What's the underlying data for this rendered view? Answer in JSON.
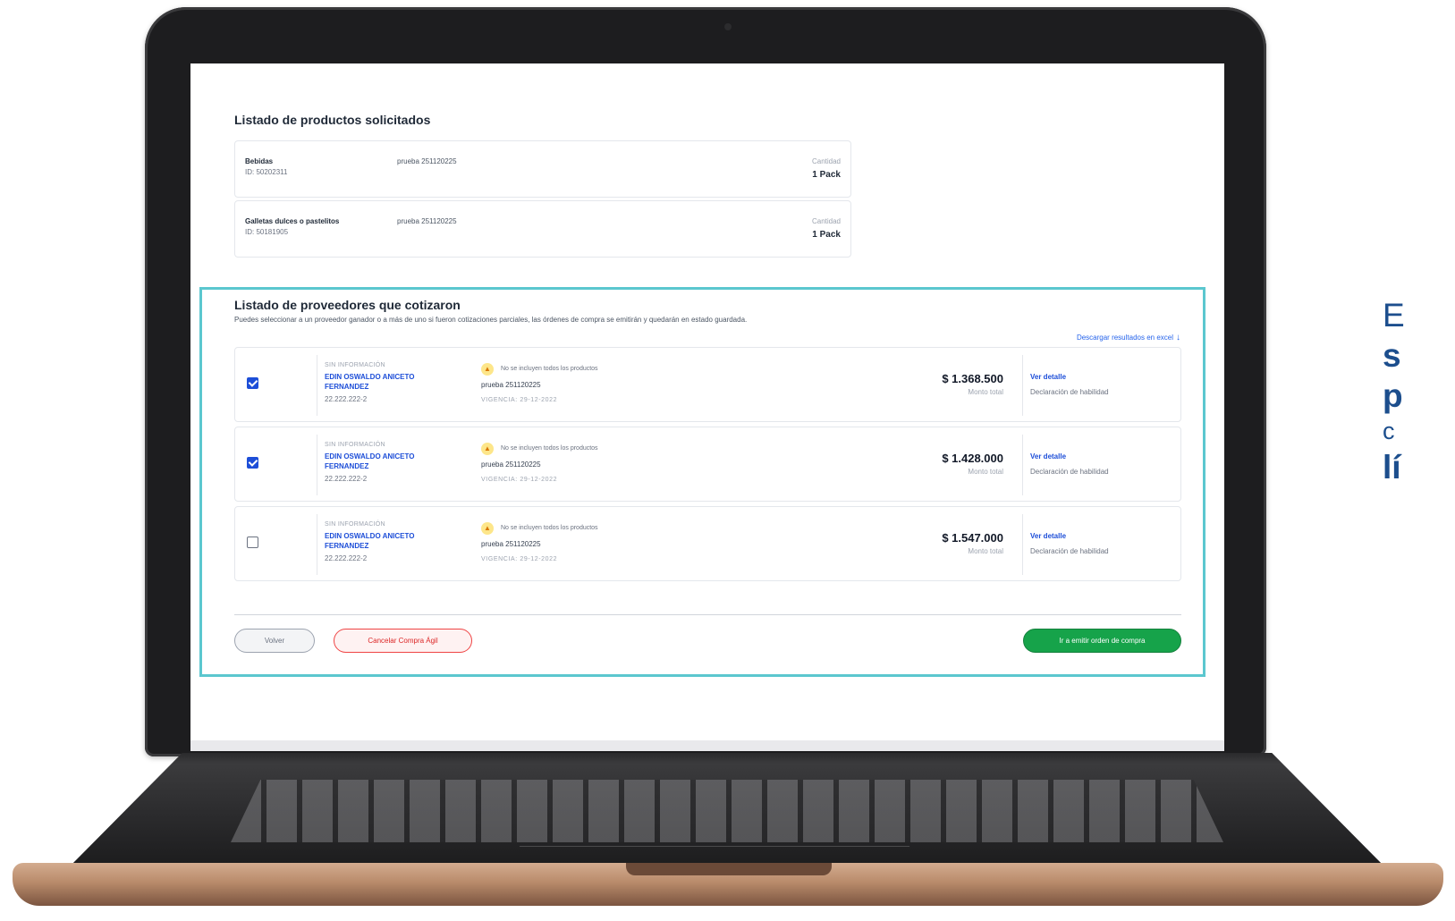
{
  "products_section": {
    "title": "Listado de productos solicitados",
    "items": [
      {
        "name": "Bebidas",
        "id": "ID: 50202311",
        "description": "prueba 251120225",
        "qty_label": "Cantidad",
        "qty": "1 Pack"
      },
      {
        "name": "Galletas dulces o pastelitos",
        "id": "ID: 50181905",
        "description": "prueba 251120225",
        "qty_label": "Cantidad",
        "qty": "1 Pack"
      }
    ]
  },
  "suppliers_section": {
    "title": "Listado de proveedores que cotizaron",
    "subtitle": "Puedes seleccionar a un proveedor ganador o a más de uno si fueron cotizaciones parciales, las órdenes de compra se emitirán y quedarán en estado guardada.",
    "excel_link": "Descargar resultados en excel",
    "highlight_color": "#5bc7cf",
    "suppliers": [
      {
        "checked": true,
        "info": "SIN INFORMACIÓN",
        "name": "EDIN OSWALDO ANICETO FERNANDEZ",
        "rut": "22.222.222-2",
        "warning": "No se incluyen todos los productos",
        "description": "prueba 251120225",
        "vigencia": "VIGENCIA: 29-12-2022",
        "amount": "$ 1.368.500",
        "amount_label": "Monto total",
        "detail_link": "Ver detalle",
        "declaration": "Declaración de habilidad"
      },
      {
        "checked": true,
        "info": "SIN INFORMACIÓN",
        "name": "EDIN OSWALDO ANICETO FERNANDEZ",
        "rut": "22.222.222-2",
        "warning": "No se incluyen todos los productos",
        "description": "prueba 251120225",
        "vigencia": "VIGENCIA: 29-12-2022",
        "amount": "$ 1.428.000",
        "amount_label": "Monto total",
        "detail_link": "Ver detalle",
        "declaration": "Declaración de habilidad"
      },
      {
        "checked": false,
        "info": "SIN INFORMACIÓN",
        "name": "EDIN OSWALDO ANICETO FERNANDEZ",
        "rut": "22.222.222-2",
        "warning": "No se incluyen todos los productos",
        "description": "prueba 251120225",
        "vigencia": "VIGENCIA: 29-12-2022",
        "amount": "$ 1.547.000",
        "amount_label": "Monto total",
        "detail_link": "Ver detalle",
        "declaration": "Declaración de habilidad"
      }
    ]
  },
  "actions": {
    "back": "Volver",
    "cancel": "Cancelar Compra Ágil",
    "emit": "Ir a emitir orden de compra"
  },
  "side_caption": {
    "line1": "E",
    "line2": "s",
    "line3": "p",
    "line4": "c",
    "line5": "lí"
  },
  "colors": {
    "primary_blue": "#1d4ed8",
    "success_green": "#16a34a",
    "danger_red": "#dc2626",
    "caption_blue": "#1c4e8d"
  }
}
